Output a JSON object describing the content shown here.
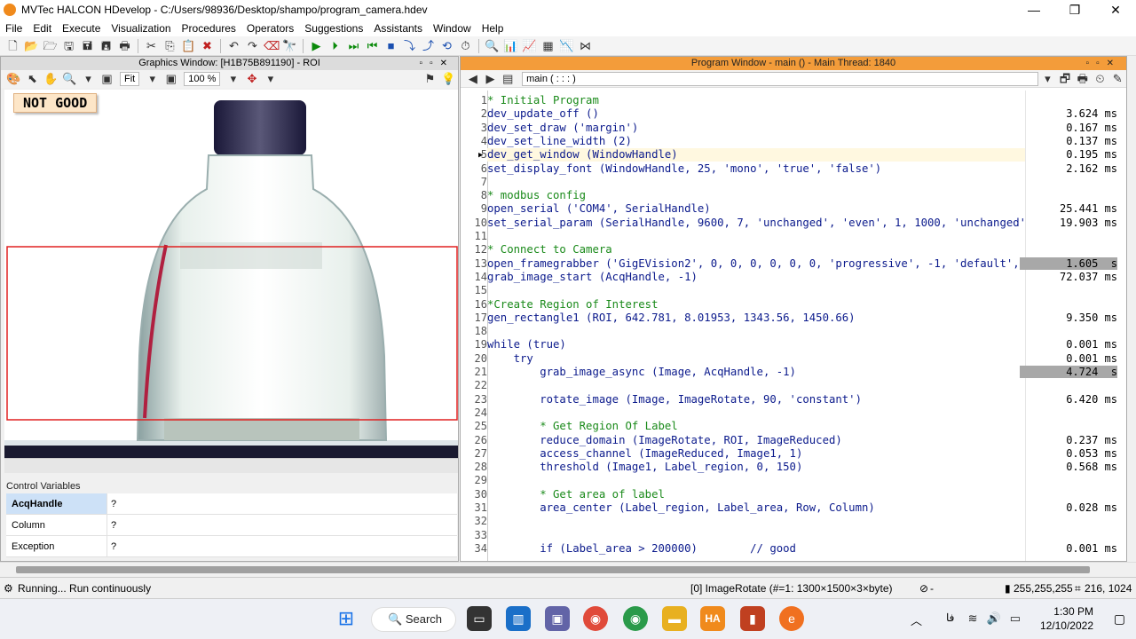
{
  "app": {
    "title": "MVTec HALCON HDevelop - C:/Users/98936/Desktop/shampo/program_camera.hdev"
  },
  "menu": [
    "File",
    "Edit",
    "Execute",
    "Visualization",
    "Procedures",
    "Operators",
    "Suggestions",
    "Assistants",
    "Window",
    "Help"
  ],
  "graphics": {
    "title": "Graphics Window: [H1B75B891190] - ROI",
    "fit": "Fit",
    "zoom": "100 %",
    "badge": "NOT GOOD"
  },
  "control_vars": {
    "label": "Control Variables",
    "rows": [
      {
        "name": "AcqHandle",
        "value": "?"
      },
      {
        "name": "Column",
        "value": "?"
      },
      {
        "name": "Exception",
        "value": "?"
      }
    ]
  },
  "program": {
    "title": "Program Window - main () - Main Thread: 1840",
    "procedure": "main ( : : : )",
    "lines": [
      {
        "n": "1",
        "code": "* Initial Program",
        "c": true,
        "t": ""
      },
      {
        "n": "2",
        "code": "dev_update_off ()",
        "c": false,
        "t": "3.624 ms"
      },
      {
        "n": "3",
        "code": "dev_set_draw ('margin')",
        "c": false,
        "t": "0.167 ms"
      },
      {
        "n": "4",
        "code": "dev_set_line_width (2)",
        "c": false,
        "t": "0.137 ms"
      },
      {
        "n": "5",
        "code": "dev_get_window (WindowHandle)",
        "c": false,
        "t": "0.195 ms"
      },
      {
        "n": "6",
        "code": "set_display_font (WindowHandle, 25, 'mono', 'true', 'false')",
        "c": false,
        "t": "2.162 ms"
      },
      {
        "n": "7",
        "code": "",
        "c": false,
        "t": ""
      },
      {
        "n": "8",
        "code": "* modbus config",
        "c": true,
        "t": ""
      },
      {
        "n": "9",
        "code": "open_serial ('COM4', SerialHandle)",
        "c": false,
        "t": "25.441 ms"
      },
      {
        "n": "10",
        "code": "set_serial_param (SerialHandle, 9600, 7, 'unchanged', 'even', 1, 1000, 'unchanged'",
        "c": false,
        "t": "19.903 ms"
      },
      {
        "n": "11",
        "code": "",
        "c": false,
        "t": ""
      },
      {
        "n": "12",
        "code": "* Connect to Camera",
        "c": true,
        "t": ""
      },
      {
        "n": "13",
        "code": "open_framegrabber ('GigEVision2', 0, 0, 0, 0, 0, 0, 'progressive', -1, 'default',",
        "c": false,
        "t": "1.605  s"
      },
      {
        "n": "14",
        "code": "grab_image_start (AcqHandle, -1)",
        "c": false,
        "t": "72.037 ms"
      },
      {
        "n": "15",
        "code": "",
        "c": false,
        "t": ""
      },
      {
        "n": "16",
        "code": "*Create Region of Interest",
        "c": true,
        "t": ""
      },
      {
        "n": "17",
        "code": "gen_rectangle1 (ROI, 642.781, 8.01953, 1343.56, 1450.66)",
        "c": false,
        "t": "9.350 ms"
      },
      {
        "n": "18",
        "code": "",
        "c": false,
        "t": ""
      },
      {
        "n": "19",
        "code": "while (true)",
        "c": false,
        "t": "0.001 ms"
      },
      {
        "n": "20",
        "code": "    try",
        "c": false,
        "t": "0.001 ms"
      },
      {
        "n": "21",
        "code": "        grab_image_async (Image, AcqHandle, -1)",
        "c": false,
        "t": "4.724  s"
      },
      {
        "n": "22",
        "code": "",
        "c": false,
        "t": ""
      },
      {
        "n": "23",
        "code": "        rotate_image (Image, ImageRotate, 90, 'constant')",
        "c": false,
        "t": "6.420 ms"
      },
      {
        "n": "24",
        "code": "",
        "c": false,
        "t": ""
      },
      {
        "n": "25",
        "code": "        * Get Region Of Label",
        "c": true,
        "t": ""
      },
      {
        "n": "26",
        "code": "        reduce_domain (ImageRotate, ROI, ImageReduced)",
        "c": false,
        "t": "0.237 ms"
      },
      {
        "n": "27",
        "code": "        access_channel (ImageReduced, Image1, 1)",
        "c": false,
        "t": "0.053 ms"
      },
      {
        "n": "28",
        "code": "        threshold (Image1, Label_region, 0, 150)",
        "c": false,
        "t": "0.568 ms"
      },
      {
        "n": "29",
        "code": "",
        "c": false,
        "t": ""
      },
      {
        "n": "30",
        "code": "        * Get area of label",
        "c": true,
        "t": ""
      },
      {
        "n": "31",
        "code": "        area_center (Label_region, Label_area, Row, Column)",
        "c": false,
        "t": "0.028 ms"
      },
      {
        "n": "32",
        "code": "",
        "c": false,
        "t": ""
      },
      {
        "n": "33",
        "code": "",
        "c": false,
        "t": ""
      },
      {
        "n": "34",
        "code": "        if (Label_area > 200000)        // good",
        "c": false,
        "t": "0.001 ms"
      }
    ]
  },
  "status": {
    "left": "Running... Run continuously",
    "image": "[0] ImageRotate (#=1: 1300×1500×3×byte)",
    "dash": "-",
    "color": "255,255,255",
    "coords": "216, 1024"
  },
  "taskbar": {
    "search": "Search",
    "time": "1:30 PM",
    "date": "12/10/2022",
    "lang": "فا"
  }
}
